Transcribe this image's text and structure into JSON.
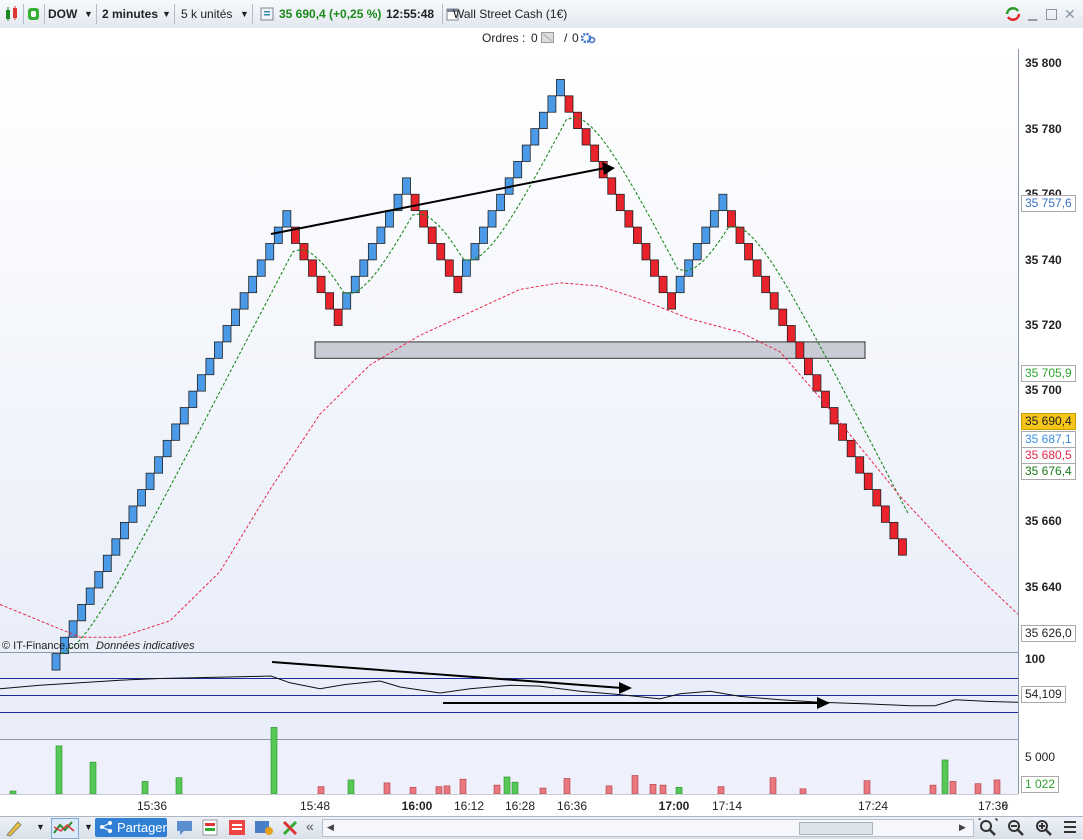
{
  "toolbar": {
    "symbol": "DOW",
    "timeframe": "2 minutes",
    "units": "5 k unités",
    "price_change": "35 690,4 (+0,25 %)",
    "time": "12:55:48",
    "instrument": "Wall Street Cash (1€)"
  },
  "orders": {
    "label": "Ordres :",
    "count_a": "0",
    "slash": "/",
    "count_b": "0"
  },
  "credit": {
    "source": "© IT-Finance.com",
    "note": "Données indicatives"
  },
  "price_axis": {
    "ticks": [
      "35 800",
      "35 780",
      "35 760",
      "35 740",
      "35 720",
      "35 700",
      "35 660",
      "35 640"
    ],
    "tags": [
      {
        "text": "35 757,6",
        "color": "#3a72c4",
        "bg": "#ffffff"
      },
      {
        "text": "35 705,9",
        "color": "#2fa52f",
        "bg": "#ffffff"
      },
      {
        "text": "35 690,4",
        "color": "#000000",
        "bg": "#f5c518"
      },
      {
        "text": "35 687,1",
        "color": "#3a8ee0",
        "bg": "#ffffff"
      },
      {
        "text": "35 680,5",
        "color": "#e0284a",
        "bg": "#ffffff"
      },
      {
        "text": "35 676,4",
        "color": "#1a7a1a",
        "bg": "#ffffff"
      },
      {
        "text": "35 626,0",
        "color": "#000000",
        "bg": "#ffffff"
      }
    ]
  },
  "rsi_axis": {
    "top": "100",
    "value": "54,109"
  },
  "vol_axis": {
    "top": "5 000",
    "value": "1 022"
  },
  "time_axis": {
    "labels": [
      "15:36",
      "15:48",
      "16:00",
      "16:12",
      "16:28",
      "16:36",
      "17:00",
      "17:14",
      "17:24",
      "17:36"
    ],
    "bold": [
      "16:00",
      "17:00"
    ]
  },
  "bottombar": {
    "share_label": "Partager"
  },
  "colors": {
    "up": "#4a9ae8",
    "down": "#e8232b",
    "ma_fast": "#1e8a1e",
    "ma_slow": "#e8284a",
    "zone": "#c9ccd4"
  },
  "chart_data": {
    "type": "renko",
    "brick_size": 5,
    "ylim": [
      35615,
      35805
    ],
    "bricks": [
      "up",
      "up",
      "up",
      "up",
      "up",
      "up",
      "up",
      "up",
      "up",
      "up",
      "up",
      "up",
      "up",
      "up",
      "up",
      "up",
      "up",
      "up",
      "up",
      "up",
      "up",
      "up",
      "up",
      "up",
      "up",
      "up",
      "up",
      "up",
      "down",
      "down",
      "down",
      "down",
      "down",
      "down",
      "up",
      "up",
      "up",
      "up",
      "up",
      "up",
      "up",
      "up",
      "down",
      "down",
      "down",
      "down",
      "down",
      "down",
      "up",
      "up",
      "up",
      "up",
      "up",
      "up",
      "up",
      "up",
      "up",
      "up",
      "up",
      "up",
      "down",
      "down",
      "down",
      "down",
      "down",
      "down",
      "down",
      "down",
      "down",
      "down",
      "down",
      "down",
      "down",
      "up",
      "up",
      "up",
      "up",
      "up",
      "up",
      "down",
      "down",
      "down",
      "down",
      "down",
      "down",
      "down",
      "down",
      "down",
      "down",
      "down",
      "down",
      "down",
      "down",
      "down",
      "down",
      "down",
      "down",
      "down",
      "down",
      "down"
    ],
    "first_brick_low": 35615,
    "zone": {
      "low": 35710,
      "high": 35715
    },
    "last_price": 35690.4,
    "rsi": {
      "overbought": 70,
      "mid": 50,
      "oversold": 30,
      "value": 54.109
    },
    "volume_scale": 5000,
    "volume_last": 1022
  }
}
